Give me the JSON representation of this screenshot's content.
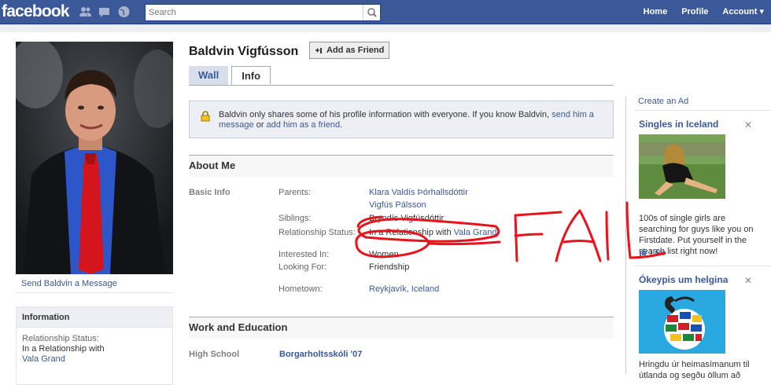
{
  "topbar": {
    "logo": "facebook",
    "search_placeholder": "Search",
    "nav": [
      "Home",
      "Profile",
      "Account"
    ]
  },
  "profile": {
    "name": "Baldvin Vigfússon",
    "add_friend": "Add as Friend",
    "tabs": [
      "Wall",
      "Info"
    ],
    "send_message": "Send Baldvin a Message"
  },
  "notice": {
    "text_before": "Baldvin only shares some of his profile information with everyone. If you know Baldvin, ",
    "link1": "send him a message",
    "text_mid": " or ",
    "link2": "add him as a friend",
    "text_after": "."
  },
  "about": {
    "heading": "About Me",
    "section_label": "Basic Info",
    "rows": [
      {
        "label": "Parents:",
        "values": [
          "Klara Valdís Þórhallsdóttir",
          "Vigfús Pálsson"
        ],
        "link": true
      },
      {
        "label": "Siblings:",
        "values": [
          "Bryndís Vigfúsdóttir"
        ],
        "link": false
      },
      {
        "label": "Relationship Status:",
        "prefix": "In a Relationship with ",
        "partner": "Vala Grand"
      },
      {
        "label": "Interested In:",
        "values": [
          "Women"
        ],
        "link": false
      },
      {
        "label": "Looking For:",
        "values": [
          "Friendship"
        ],
        "link": false
      },
      {
        "label": "Hometown:",
        "values": [
          "Reykjavík, Iceland"
        ],
        "link": true
      }
    ]
  },
  "work": {
    "heading": "Work and Education",
    "label": "High School",
    "value": "Borgarholtsskóli '07"
  },
  "info_box": {
    "heading": "Information",
    "label": "Relationship Status:",
    "value": "In a Relationship with",
    "partner": "Vala Grand"
  },
  "ads": {
    "create": "Create an Ad",
    "ad1": {
      "title": "Singles in Iceland",
      "text": "100s of single girls are searching for guys like you on Firstdate. Put yourself in the search list right now!",
      "like": "Like"
    },
    "ad2": {
      "title": "Ókeypis um helgina",
      "text": "Hringdu úr heimasímanum til útlanda og segðu öllum að"
    }
  },
  "annotation": {
    "text": "FAIL",
    "color": "#e8141b"
  }
}
